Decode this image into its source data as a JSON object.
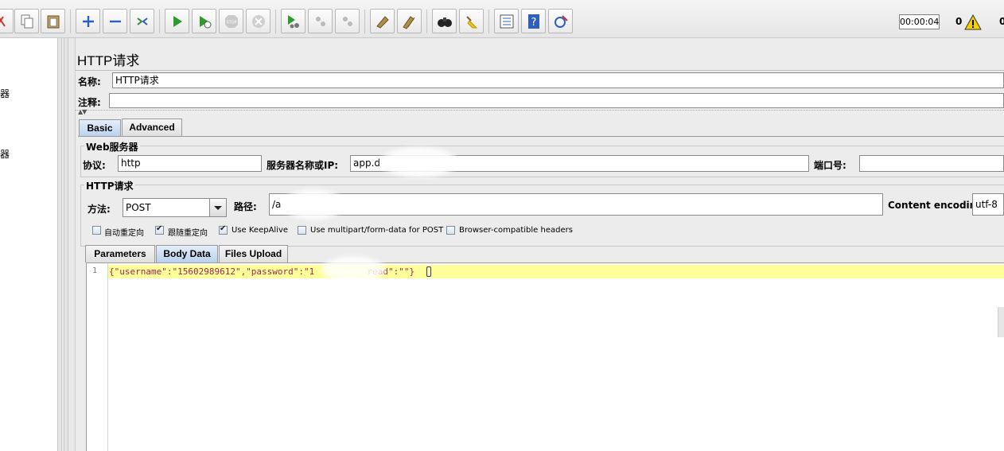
{
  "toolbar": {
    "timer": "00:00:04",
    "warning_count": "0",
    "thread_count": "0"
  },
  "tree": {
    "fragment_1": "器",
    "fragment_2": "器"
  },
  "panel": {
    "title": "HTTP请求",
    "name_label": "名称:",
    "name_value": "HTTP请求",
    "comment_label": "注释:",
    "comment_value": ""
  },
  "tabs": {
    "basic": "Basic",
    "advanced": "Advanced"
  },
  "web_server": {
    "group_title": "Web服务器",
    "protocol_label": "协议:",
    "protocol_value": "http",
    "server_label": "服务器名称或IP:",
    "server_value": "app.d",
    "port_label": "端口号:",
    "port_value": ""
  },
  "http_request": {
    "group_title": "HTTP请求",
    "method_label": "方法:",
    "method_value": "POST",
    "path_label": "路径:",
    "path_value": "/a",
    "encoding_label": "Content encoding:",
    "encoding_value": "utf-8"
  },
  "options": [
    {
      "label": "自动重定向",
      "checked": false
    },
    {
      "label": "跟随重定向",
      "checked": true
    },
    {
      "label": "Use KeepAlive",
      "checked": true
    },
    {
      "label": "Use multipart/form-data for POST",
      "checked": false
    },
    {
      "label": "Browser-compatible headers",
      "checked": false
    }
  ],
  "subtabs": {
    "parameters": "Parameters",
    "body_data": "Body Data",
    "files_upload": "Files Upload"
  },
  "editor": {
    "line_number": "1",
    "line_1": "{\"username\":\"15602989612\",\"password\":\"1          read\":\"\"}"
  },
  "colors": {
    "accent_tab": "#b9d1ec",
    "code_text": "#a6205f",
    "current_line": "#ffff99"
  }
}
